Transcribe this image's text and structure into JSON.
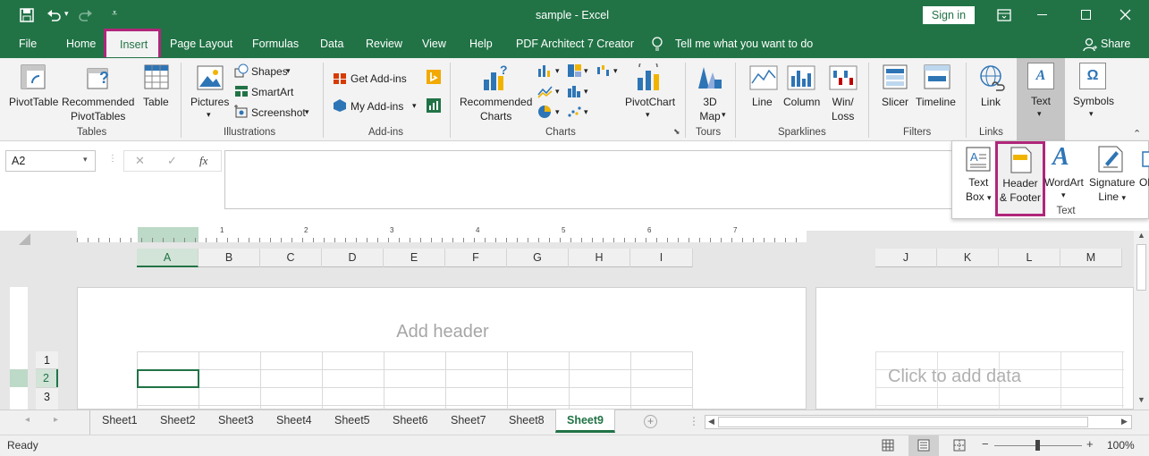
{
  "window": {
    "title": "sample - Excel",
    "signin": "Sign in"
  },
  "tabs": [
    "File",
    "Home",
    "Insert",
    "Page Layout",
    "Formulas",
    "Data",
    "Review",
    "View",
    "Help",
    "PDF Architect 7 Creator"
  ],
  "tellme": "Tell me what you want to do",
  "share": "Share",
  "ribbon": {
    "tables": {
      "pivot": "PivotTable",
      "rec1": "Recommended",
      "rec2": "PivotTables",
      "table": "Table",
      "label": "Tables"
    },
    "illustrations": {
      "pictures": "Pictures",
      "shapes": "Shapes",
      "smartart": "SmartArt",
      "screenshot": "Screenshot",
      "label": "Illustrations"
    },
    "addins": {
      "get": "Get Add-ins",
      "my": "My Add-ins",
      "label": "Add-ins"
    },
    "charts": {
      "rec1": "Recommended",
      "rec2": "Charts",
      "pivotchart": "PivotChart",
      "label": "Charts"
    },
    "tours": {
      "map1": "3D",
      "map2": "Map",
      "label": "Tours"
    },
    "sparklines": {
      "line": "Line",
      "column": "Column",
      "winloss1": "Win/",
      "winloss2": "Loss",
      "label": "Sparklines"
    },
    "filters": {
      "slicer": "Slicer",
      "timeline": "Timeline",
      "label": "Filters"
    },
    "links": {
      "link": "Link",
      "label": "Links"
    },
    "text": {
      "text": "Text"
    },
    "symbols": {
      "symbols": "Symbols"
    }
  },
  "textdrop": {
    "textbox1": "Text",
    "textbox2": "Box",
    "hf1": "Header",
    "hf2": "& Footer",
    "wordart": "WordArt",
    "sig1": "Signature",
    "sig2": "Line",
    "ob": "Ol",
    "label": "Text"
  },
  "namebox": "A2",
  "fx": "fx",
  "columns": [
    "A",
    "B",
    "C",
    "D",
    "E",
    "F",
    "G",
    "H",
    "I"
  ],
  "columns2": [
    "J",
    "K",
    "L",
    "M"
  ],
  "rows": [
    "1",
    "2",
    "3"
  ],
  "ruler": [
    "1",
    "2",
    "3",
    "4",
    "5",
    "6",
    "7"
  ],
  "page": {
    "add_header": "Add header",
    "click_add": "Click to add data"
  },
  "sheets": [
    "Sheet1",
    "Sheet2",
    "Sheet3",
    "Sheet4",
    "Sheet5",
    "Sheet6",
    "Sheet7",
    "Sheet8",
    "Sheet9"
  ],
  "status": {
    "ready": "Ready",
    "zoom": "100%"
  },
  "colors": {
    "accent": "#217346",
    "highlight": "#b0267a"
  }
}
